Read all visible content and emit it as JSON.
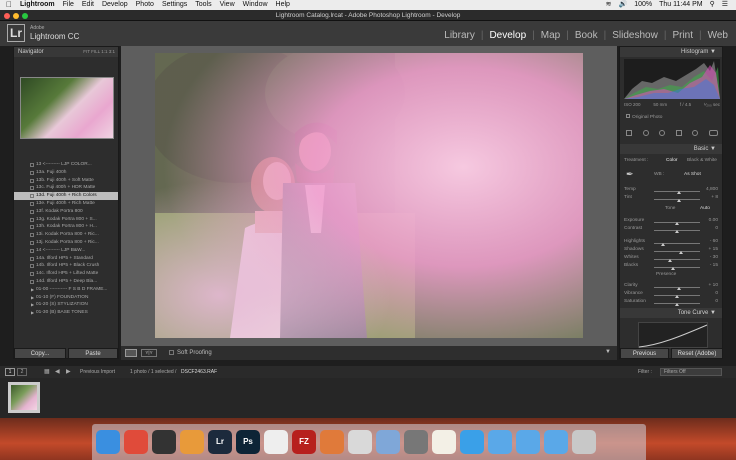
{
  "menubar": {
    "app": "Lightroom",
    "items": [
      "File",
      "Edit",
      "Develop",
      "Photo",
      "Settings",
      "Tools",
      "View",
      "Window",
      "Help"
    ],
    "battery": "100%",
    "clock": "Thu 11:44 PM"
  },
  "window": {
    "title": "Lightroom Catalog.lrcat - Adobe Photoshop Lightroom - Develop"
  },
  "identity": {
    "logo": "Lr",
    "vendor": "Adobe",
    "product": "Lightroom CC",
    "modules": [
      "Library",
      "Develop",
      "Map",
      "Book",
      "Slideshow",
      "Print",
      "Web"
    ],
    "active_module": "Develop"
  },
  "navigator": {
    "title": "Navigator",
    "zoom_options": "FIT  FILL  1:1  3:1"
  },
  "presets": [
    {
      "label": "13 <--------- LJP COLOR...",
      "selected": false,
      "folder": false
    },
    {
      "label": "13a. Fuji 400h",
      "selected": false,
      "folder": false
    },
    {
      "label": "13b. Fuji 400h + Soft Matte",
      "selected": false,
      "folder": false
    },
    {
      "label": "13c. Fuji 400h + HDR Matte",
      "selected": false,
      "folder": false
    },
    {
      "label": "13d. Fuji 400h + Rich Colors",
      "selected": true,
      "folder": false
    },
    {
      "label": "13e. Fuji 400h + Rich Matte",
      "selected": false,
      "folder": false
    },
    {
      "label": "13f. Kodak Portra 800",
      "selected": false,
      "folder": false
    },
    {
      "label": "13g. Kodak Portra 800 + S...",
      "selected": false,
      "folder": false
    },
    {
      "label": "13h. Kodak Portra 800 + H...",
      "selected": false,
      "folder": false
    },
    {
      "label": "13i. Kodak Portra 800 + Ric...",
      "selected": false,
      "folder": false
    },
    {
      "label": "13j. Kodak Portra 800 + Ric...",
      "selected": false,
      "folder": false
    },
    {
      "label": "14 <--------- LJP B&W...",
      "selected": false,
      "folder": false
    },
    {
      "label": "14a. Ilford HP5 + Standard",
      "selected": false,
      "folder": false
    },
    {
      "label": "14b. Ilford HP5 + Black Crush",
      "selected": false,
      "folder": false
    },
    {
      "label": "14c. Ilford HP5 + Lifted Matte",
      "selected": false,
      "folder": false
    },
    {
      "label": "14d. Ilford HP5 + Deep Bla...",
      "selected": false,
      "folder": false
    },
    {
      "label": "01-00 ----------- F S B D FRAME...",
      "selected": false,
      "folder": true
    },
    {
      "label": "01-10 (F) FOUNDATION",
      "selected": false,
      "folder": true
    },
    {
      "label": "01-20 (S) STYLIZATION",
      "selected": false,
      "folder": true
    },
    {
      "label": "01-30 (B) BASE TONES",
      "selected": false,
      "folder": true
    }
  ],
  "left_buttons": {
    "copy": "Copy...",
    "paste": "Paste"
  },
  "toolbar": {
    "view_toggle": "Y|Y",
    "soft_proofing": "Soft Proofing"
  },
  "histogram": {
    "title": "Histogram",
    "iso": "ISO 200",
    "focal": "50 mm",
    "aperture": "f / 4.5",
    "shutter": "¹⁄₂₀₀ sec",
    "original_photo": "Original Photo"
  },
  "basic": {
    "title": "Basic",
    "treatment_label": "Treatment :",
    "color": "Color",
    "bw": "Black & White",
    "wb_label": "WB :",
    "wb_value": "As Shot",
    "tone_label": "Tone",
    "auto_label": "Auto",
    "presence_label": "Presence",
    "sliders": [
      {
        "label": "Temp",
        "value": "4,800",
        "position": 0.55
      },
      {
        "label": "Tint",
        "value": "+ 8",
        "position": 0.55
      },
      {
        "label": "Exposure",
        "value": "0.00",
        "position": 0.5
      },
      {
        "label": "Contrast",
        "value": "0",
        "position": 0.5
      },
      {
        "label": "Highlights",
        "value": "- 60",
        "position": 0.2
      },
      {
        "label": "Shadows",
        "value": "+ 15",
        "position": 0.58
      },
      {
        "label": "Whites",
        "value": "- 30",
        "position": 0.35
      },
      {
        "label": "Blacks",
        "value": "- 15",
        "position": 0.42
      },
      {
        "label": "Clarity",
        "value": "+ 10",
        "position": 0.55
      },
      {
        "label": "Vibrance",
        "value": "0",
        "position": 0.5
      },
      {
        "label": "Saturation",
        "value": "0",
        "position": 0.5
      }
    ]
  },
  "tone_curve": {
    "title": "Tone Curve"
  },
  "right_buttons": {
    "previous": "Previous",
    "reset": "Reset (Adobe)"
  },
  "filmstrip": {
    "pages": [
      "1",
      "2"
    ],
    "source": "Previous Import",
    "selection": "1 photo / 1 selected /",
    "filename": "DSCF2463.RAF",
    "filter_label": "Filter :",
    "filter_value": "Filters Off"
  },
  "dock": [
    {
      "name": "finder",
      "label": "",
      "color": "#3a8fe0"
    },
    {
      "name": "chrome",
      "label": "",
      "color": "#e04b3a"
    },
    {
      "name": "aperture",
      "label": "",
      "color": "#333"
    },
    {
      "name": "photos",
      "label": "",
      "color": "#e89a3a"
    },
    {
      "name": "lightroom",
      "label": "Lr",
      "color": "#1c2a3c"
    },
    {
      "name": "photoshop",
      "label": "Ps",
      "color": "#0d2436"
    },
    {
      "name": "textedit",
      "label": "",
      "color": "#eeeeee"
    },
    {
      "name": "filezilla",
      "label": "FZ",
      "color": "#b7201d"
    },
    {
      "name": "brackets",
      "label": "",
      "color": "#e07a3a"
    },
    {
      "name": "acrobat",
      "label": "",
      "color": "#d9d9d9"
    },
    {
      "name": "preview",
      "label": "",
      "color": "#7fa7d8"
    },
    {
      "name": "sys-prefs",
      "label": "",
      "color": "#777777"
    },
    {
      "name": "notes",
      "label": "",
      "color": "#f3f0e6"
    },
    {
      "name": "safari",
      "label": "",
      "color": "#3aa0e8"
    },
    {
      "name": "apps-folder",
      "label": "",
      "color": "#5aa8e8"
    },
    {
      "name": "docs-folder",
      "label": "",
      "color": "#5aa8e8"
    },
    {
      "name": "downloads-folder",
      "label": "",
      "color": "#5aa8e8"
    },
    {
      "name": "trash",
      "label": "",
      "color": "#c8c8c8"
    }
  ]
}
